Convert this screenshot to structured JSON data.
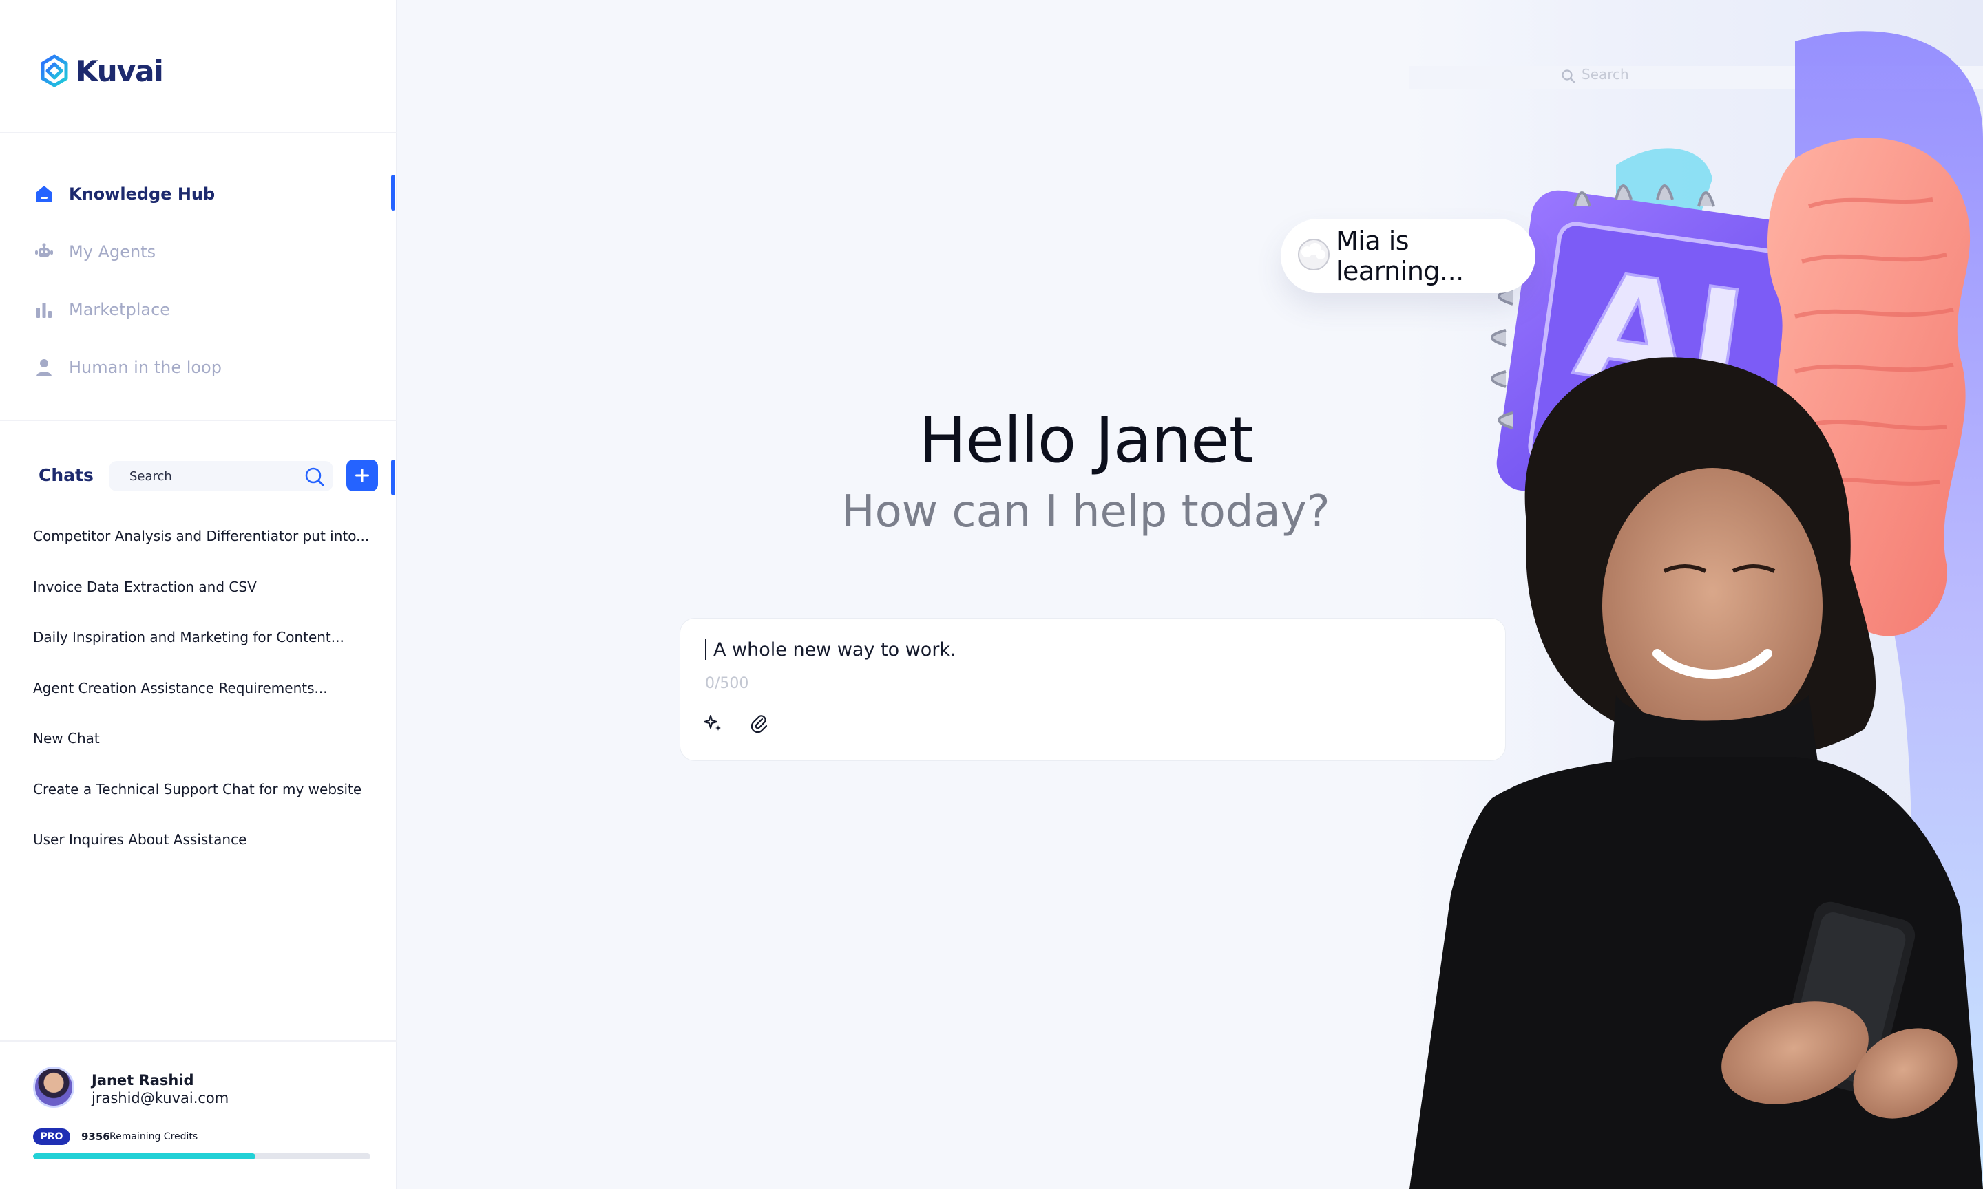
{
  "brand": {
    "name": "Kuvai"
  },
  "nav": [
    {
      "label": "Knowledge Hub",
      "icon": "home-icon",
      "active": true
    },
    {
      "label": "My Agents",
      "icon": "robot-icon",
      "active": false
    },
    {
      "label": "Marketplace",
      "icon": "bar-chart-icon",
      "active": false
    },
    {
      "label": "Human in the loop",
      "icon": "person-icon",
      "active": false
    }
  ],
  "chats": {
    "title": "Chats",
    "search_placeholder": "Search",
    "items": [
      "Competitor Analysis and Differentiator put into...",
      "Invoice Data Extraction and CSV",
      "Daily Inspiration and Marketing for Content...",
      "Agent Creation Assistance Requirements...",
      "New Chat",
      "Create a Technical Support Chat for my website",
      "User Inquires About Assistance"
    ]
  },
  "user": {
    "name": "Janet Rashid",
    "email": "jrashid@kuvai.com",
    "plan": "PRO",
    "credits": "9356",
    "credits_label": "Remaining Credits",
    "credits_fraction": 0.66
  },
  "main": {
    "greeting": "Hello Janet",
    "subtitle": "How can I help today?",
    "prompt_text": "A whole new way to work.",
    "char_count": "0/500",
    "status_bubble": "Mia is learning...",
    "hero_search_placeholder": "Search",
    "chip_label": "AI"
  },
  "colors": {
    "accent": "#2563ff",
    "brand_dark": "#1d2a6e",
    "progress": "#22d1d6",
    "pro_badge": "#1f2fb4"
  }
}
